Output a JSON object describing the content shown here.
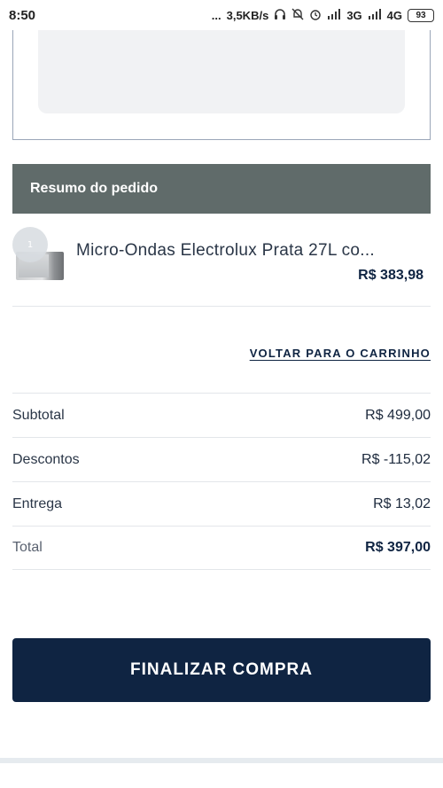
{
  "status_bar": {
    "time": "8:50",
    "dots": "...",
    "network_speed": "3,5KB/s",
    "network_3g": "3G",
    "network_4g": "4G",
    "battery": "93"
  },
  "summary": {
    "title": "Resumo do pedido"
  },
  "product": {
    "quantity": "1",
    "name": "Micro-Ondas Electrolux Prata 27L co...",
    "price": "R$ 383,98"
  },
  "back_to_cart": "VOLTAR PARA O CARRINHO",
  "totals": [
    {
      "label": "Subtotal",
      "value": "R$ 499,00"
    },
    {
      "label": "Descontos",
      "value": "R$ -115,02"
    },
    {
      "label": "Entrega",
      "value": "R$ 13,02"
    },
    {
      "label": "Total",
      "value": "R$ 397,00"
    }
  ],
  "finalize_button": "FINALIZAR COMPRA",
  "colors": {
    "header_bg": "#606b6a",
    "primary": "#0f2442"
  }
}
